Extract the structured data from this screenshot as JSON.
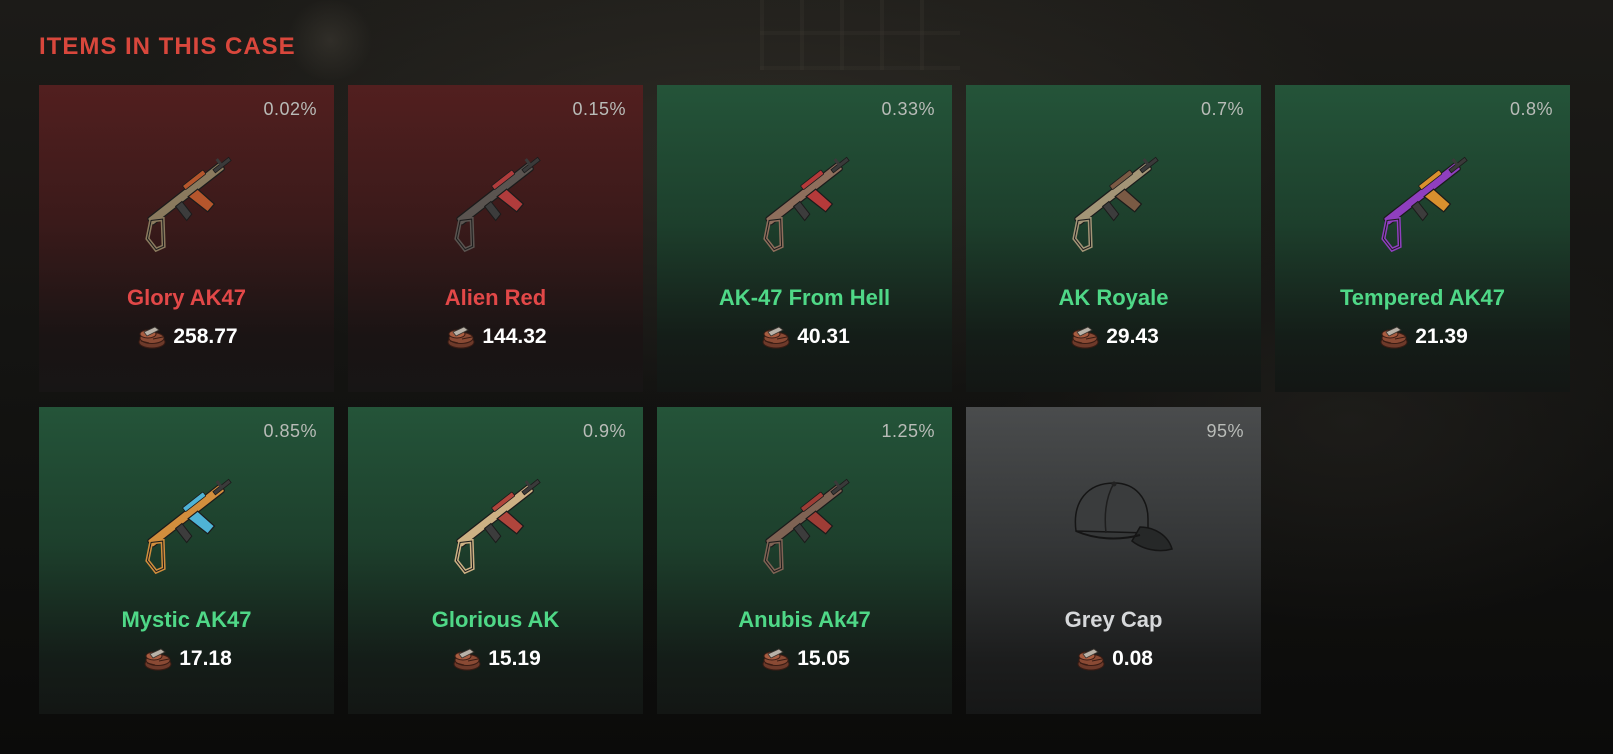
{
  "section": {
    "title": "ITEMS IN THIS CASE"
  },
  "items": [
    {
      "name": "Glory AK47",
      "chance": "0.02%",
      "price": "258.77",
      "rarity": "covert",
      "icon": "ak47-rifle-icon",
      "colors": [
        "#8a7a5e",
        "#b5562c"
      ]
    },
    {
      "name": "Alien Red",
      "chance": "0.15%",
      "price": "144.32",
      "rarity": "covert",
      "icon": "ak47-rifle-icon",
      "colors": [
        "#5a5450",
        "#b03c3c"
      ]
    },
    {
      "name": "AK-47 From Hell",
      "chance": "0.33%",
      "price": "40.31",
      "rarity": "rare",
      "icon": "ak47-rifle-icon",
      "colors": [
        "#8e6e5c",
        "#b53a3a"
      ]
    },
    {
      "name": "AK Royale",
      "chance": "0.7%",
      "price": "29.43",
      "rarity": "rare",
      "icon": "ak47-rifle-icon",
      "colors": [
        "#a39577",
        "#7a5a44"
      ]
    },
    {
      "name": "Tempered AK47",
      "chance": "0.8%",
      "price": "21.39",
      "rarity": "rare",
      "icon": "ak47-rifle-icon",
      "colors": [
        "#8f3fbf",
        "#d9902e"
      ]
    },
    {
      "name": "Mystic AK47",
      "chance": "0.85%",
      "price": "17.18",
      "rarity": "rare",
      "icon": "ak47-rifle-icon",
      "colors": [
        "#d28e3d",
        "#4fb3d6"
      ]
    },
    {
      "name": "Glorious AK",
      "chance": "0.9%",
      "price": "15.19",
      "rarity": "rare",
      "icon": "ak47-rifle-icon",
      "colors": [
        "#cdb184",
        "#b0453c"
      ]
    },
    {
      "name": "Anubis Ak47",
      "chance": "1.25%",
      "price": "15.05",
      "rarity": "rare",
      "icon": "ak47-rifle-icon",
      "colors": [
        "#7f6354",
        "#9e3d36"
      ]
    },
    {
      "name": "Grey Cap",
      "chance": "95%",
      "price": "0.08",
      "rarity": "common",
      "icon": "baseball-cap-icon",
      "colors": [
        "#3a3c3d",
        "#262828"
      ]
    }
  ],
  "currency_icon": "scrap-coin-icon",
  "rarity_colors": {
    "covert": "#e24848",
    "rare": "#4fd887",
    "common": "#d6d8da",
    "title": "#d9473c"
  }
}
